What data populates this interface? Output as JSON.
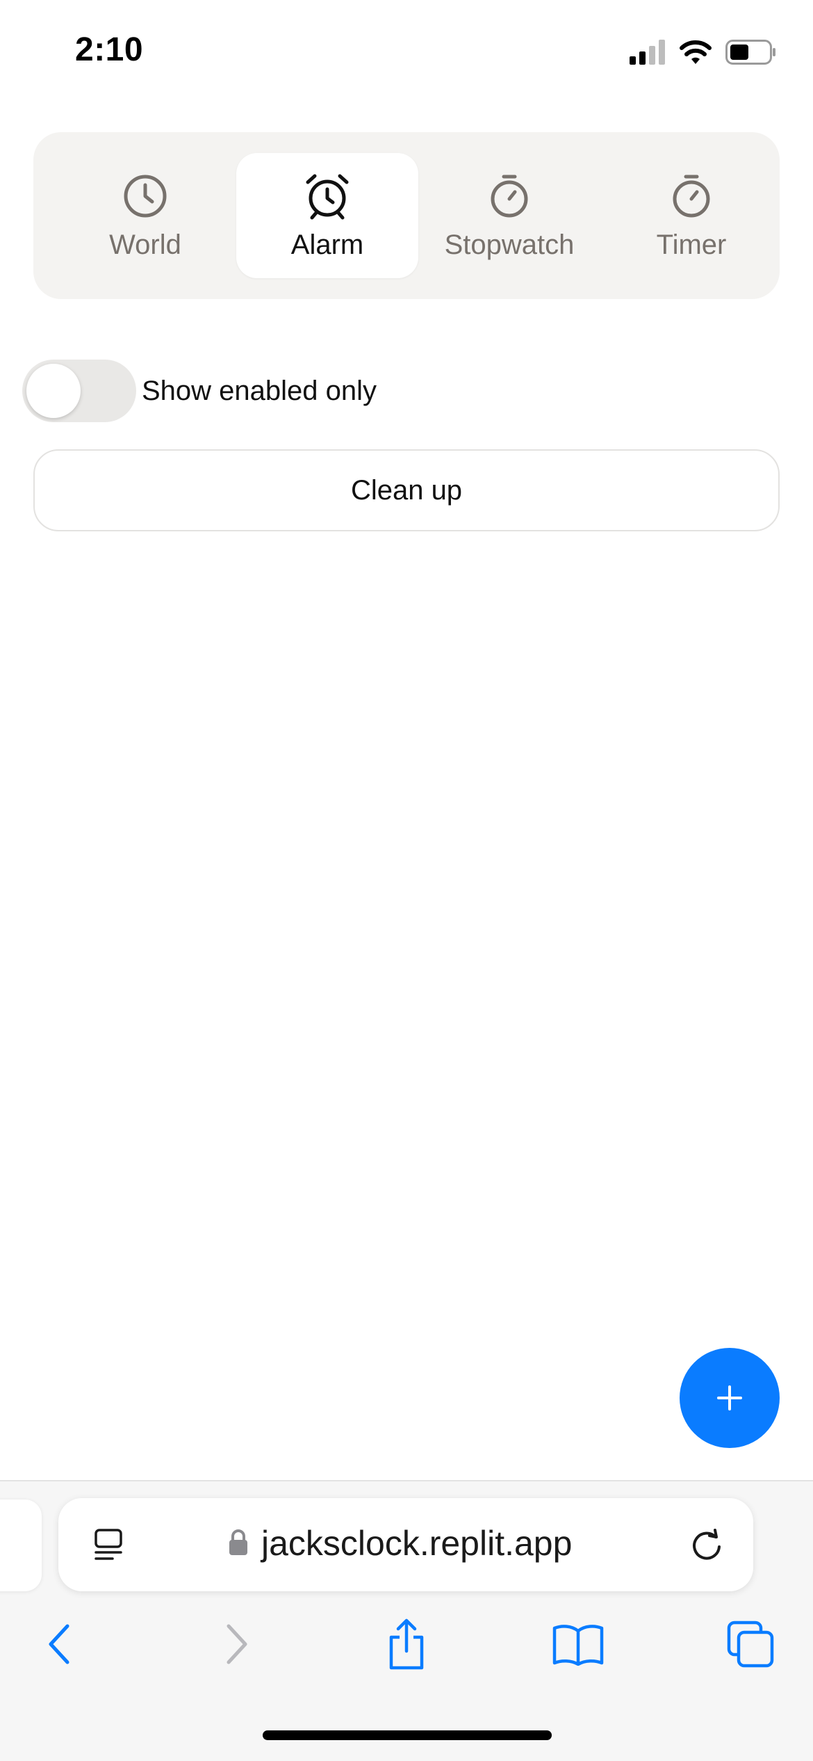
{
  "status_bar": {
    "time": "2:10",
    "icons": [
      "cellular-signal-icon",
      "wifi-icon",
      "battery-icon"
    ]
  },
  "tabs": [
    {
      "label": "World",
      "icon": "clock-icon",
      "active": false
    },
    {
      "label": "Alarm",
      "icon": "alarm-clock-icon",
      "active": true
    },
    {
      "label": "Stopwatch",
      "icon": "stopwatch-icon",
      "active": false
    },
    {
      "label": "Timer",
      "icon": "timer-icon",
      "active": false
    }
  ],
  "filter": {
    "toggle_label": "Show enabled only",
    "enabled": false
  },
  "cleanup_button": {
    "label": "Clean up"
  },
  "fab": {
    "icon": "plus-icon"
  },
  "browser": {
    "url": "jacksclock.replit.app",
    "icons": [
      "tab-overview-icon",
      "lock-icon",
      "reload-icon"
    ],
    "nav": [
      "back-icon",
      "forward-icon",
      "share-icon",
      "bookmarks-icon",
      "tabs-icon"
    ]
  },
  "colors": {
    "accent": "#0a7cff",
    "tab_inactive": "#77716c",
    "segmented_bg": "#f4f3f1"
  }
}
